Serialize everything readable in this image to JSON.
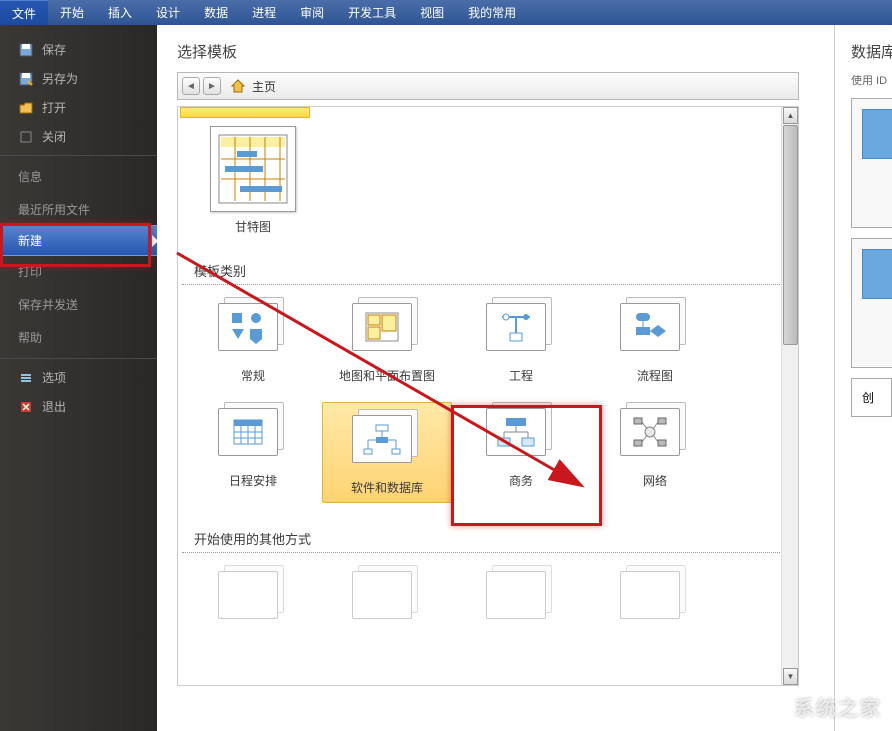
{
  "ribbon": {
    "tabs": [
      "文件",
      "开始",
      "插入",
      "设计",
      "数据",
      "进程",
      "审阅",
      "开发工具",
      "视图",
      "我的常用"
    ],
    "active_index": 0
  },
  "file_menu": {
    "items": [
      {
        "label": "保存",
        "icon": "save"
      },
      {
        "label": "另存为",
        "icon": "saveas"
      },
      {
        "label": "打开",
        "icon": "open"
      },
      {
        "label": "关闭",
        "icon": "close"
      }
    ],
    "info_label": "信息",
    "recent_label": "最近所用文件",
    "new_label": "新建",
    "print_label": "打印",
    "save_send_label": "保存并发送",
    "help_label": "帮助",
    "options_label": "选项",
    "exit_label": "退出"
  },
  "content": {
    "section_title": "选择模板",
    "breadcrumb": {
      "home_label": "主页"
    },
    "featured_template": {
      "label": "甘特图"
    },
    "category_section_title": "模板类别",
    "categories": [
      {
        "label": "常规",
        "icon_type": "shapes"
      },
      {
        "label": "地图和平面布置图",
        "icon_type": "floorplan"
      },
      {
        "label": "工程",
        "icon_type": "engineering"
      },
      {
        "label": "流程图",
        "icon_type": "flowchart"
      },
      {
        "label": "日程安排",
        "icon_type": "calendar"
      },
      {
        "label": "软件和数据库",
        "icon_type": "database",
        "selected": true
      },
      {
        "label": "商务",
        "icon_type": "business"
      },
      {
        "label": "网络",
        "icon_type": "network"
      }
    ],
    "other_section_title": "开始使用的其他方式"
  },
  "right_panel": {
    "title": "数据库",
    "subtitle": "使用 ID",
    "create_label": "创"
  },
  "watermark": "系统之家"
}
